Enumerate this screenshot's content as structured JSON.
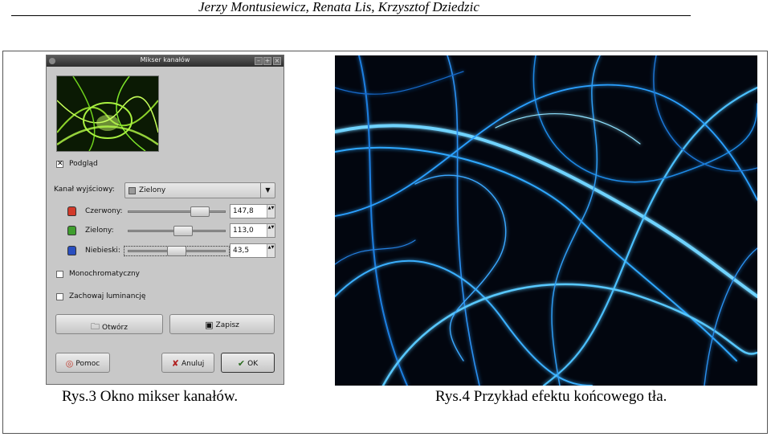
{
  "header": {
    "authors": "Jerzy Montusiewicz, Renata Lis, Krzysztof Dziedzic"
  },
  "dialog": {
    "title": "Mikser kanałów",
    "titlebar_buttons": [
      "–",
      "+",
      "×"
    ],
    "preview_label": "Podgląd",
    "preview_checked": "✕",
    "output_channel_label": "Kanał wyjściowy:",
    "output_channel_value": "Zielony",
    "combo_arrow": "▼",
    "channels": [
      {
        "label": "Czerwony:",
        "value": "147,8",
        "level": 0.74,
        "color": "#d23a2a"
      },
      {
        "label": "Zielony:",
        "value": "113,0",
        "level": 0.57,
        "color": "#3f9e2e"
      },
      {
        "label": "Niebieski:",
        "value": "43,5",
        "level": 0.5,
        "color": "#2a4fc0"
      }
    ],
    "spin_arrows": "▲▼",
    "monochrome_label": "Monochromatyczny",
    "preserve_luminosity_label": "Zachowaj luminancję",
    "open_button": "Otwórz",
    "save_button": "Zapisz",
    "help_button": "Pomoc",
    "cancel_button": "Anuluj",
    "ok_button": "OK",
    "icons": {
      "open": "folder-open-icon",
      "save": "floppy-disk-icon",
      "help": "life-ring-icon",
      "cancel": "x-icon",
      "ok": "check-icon"
    }
  },
  "captions": {
    "left": "Rys.3 Okno mikser kanałów.",
    "right": "Rys.4 Przykład efektu końcowego tła."
  },
  "colors": {
    "titlebar": "#3a3a3a",
    "dialog_bg": "#c8c8c8",
    "photo_bg": "#02060f",
    "glow_blue": "#2fa8ff",
    "glow_green": "#9be830"
  }
}
